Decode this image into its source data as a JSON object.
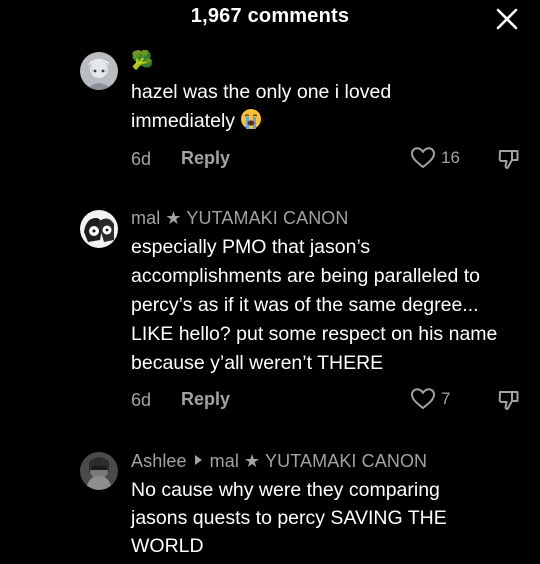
{
  "header": {
    "title": "1,967 comments",
    "close_icon": "close-icon"
  },
  "colors": {
    "background": "#000000",
    "text_primary": "#ffffff",
    "text_secondary": "#a2a2a2"
  },
  "comments": [
    {
      "username": "🥦",
      "lines": [
        "hazel was the only one i loved",
        "immediately"
      ],
      "emoji": "crying-face-icon",
      "time": "6d",
      "reply_label": "Reply",
      "likes": "16"
    },
    {
      "username": "mal ★ YUTAMAKI CANON",
      "lines": [
        "especially PMO that jason’s",
        "accomplishments are being paralleled to",
        "percy’s as if it was of the same degree...",
        "LIKE hello? put some respect on his name",
        "because y’all weren’t THERE"
      ],
      "time": "6d",
      "reply_label": "Reply",
      "likes": "7"
    },
    {
      "username": "Ashlee",
      "reply_to": "mal ★ YUTAMAKI CANON",
      "lines": [
        "No cause why were they comparing",
        "jasons quests to percy SAVING THE",
        "WORLD"
      ]
    }
  ]
}
